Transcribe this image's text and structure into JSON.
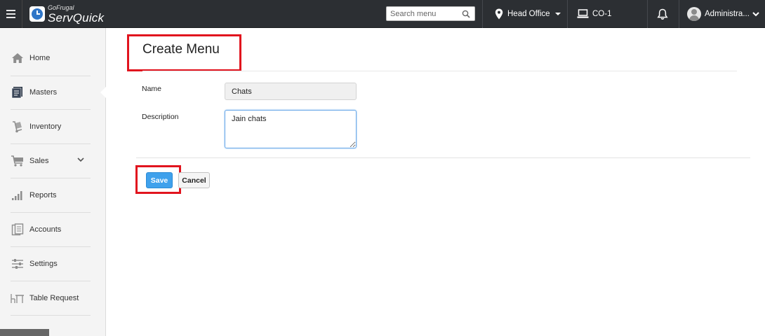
{
  "app": {
    "brand_top": "GoFrugal",
    "brand_main": "ServQuick"
  },
  "topbar": {
    "search_placeholder": "Search menu",
    "location_label": "Head Office",
    "counter_label": "CO-1",
    "user_label": "Administra...",
    "icons": [
      "menu-icon",
      "search-icon",
      "location-pin-icon",
      "monitor-icon",
      "bell-icon",
      "user-avatar-icon"
    ]
  },
  "sidebar": {
    "items": [
      {
        "label": "Home",
        "icon": "home-icon"
      },
      {
        "label": "Masters",
        "icon": "book-icon",
        "active": true
      },
      {
        "label": "Inventory",
        "icon": "hand-truck-icon"
      },
      {
        "label": "Sales",
        "icon": "cart-icon",
        "expandable": true
      },
      {
        "label": "Reports",
        "icon": "bar-chart-icon"
      },
      {
        "label": "Accounts",
        "icon": "ledger-icon"
      },
      {
        "label": "Settings",
        "icon": "sliders-icon"
      },
      {
        "label": "Table Request",
        "icon": "table-icon"
      }
    ]
  },
  "form": {
    "title": "Create Menu",
    "name_label": "Name",
    "name_value": "Chats",
    "description_label": "Description",
    "description_value": "Jain chats",
    "save_label": "Save",
    "cancel_label": "Cancel"
  },
  "colors": {
    "topbar_bg": "#2c2f33",
    "sidebar_bg": "#f4f4f4",
    "primary_button": "#3fa1ec",
    "highlight_box": "#e1141e"
  }
}
